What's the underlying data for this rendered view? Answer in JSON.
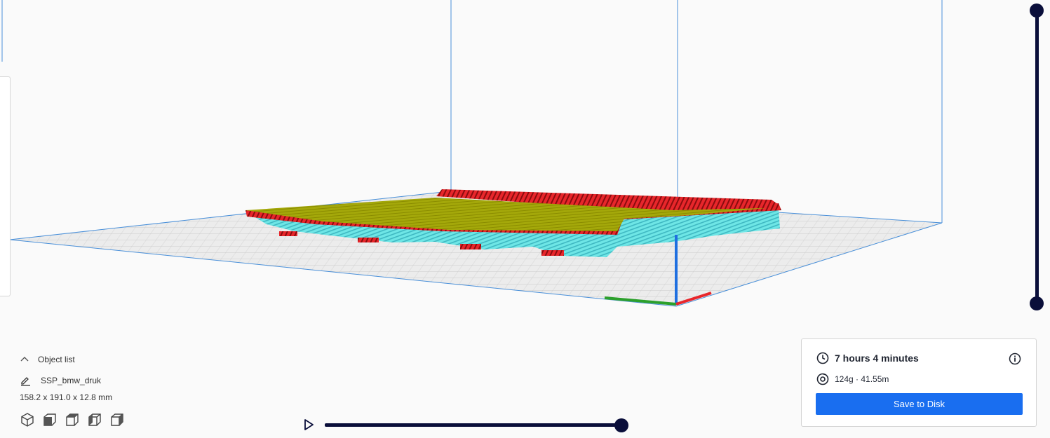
{
  "object_list": {
    "header": "Object list",
    "object_name": "SSP_bmw_druk",
    "dimensions": "158.2 x 191.0 x 12.8 mm",
    "view_buttons": [
      "view-3d",
      "view-front",
      "view-top",
      "view-left",
      "view-right"
    ]
  },
  "print_info": {
    "time": "7 hours 4 minutes",
    "material": "124g · 41.55m",
    "save_label": "Save to Disk"
  },
  "layer_view": {
    "top_layer_fraction": 1.0,
    "bottom_layer_fraction": 0.0
  },
  "simulation": {
    "progress_fraction": 1.0
  },
  "colors": {
    "accent": "#196ef0",
    "slider": "#0a0e3a",
    "build_volume_lines": "#4a90d9",
    "top_skin": "#9aa000",
    "wall": "#e8262b",
    "support": "#6ee6e6",
    "axis_x": "#e8262b",
    "axis_y": "#2ca02c",
    "axis_z": "#1f6fe0"
  }
}
